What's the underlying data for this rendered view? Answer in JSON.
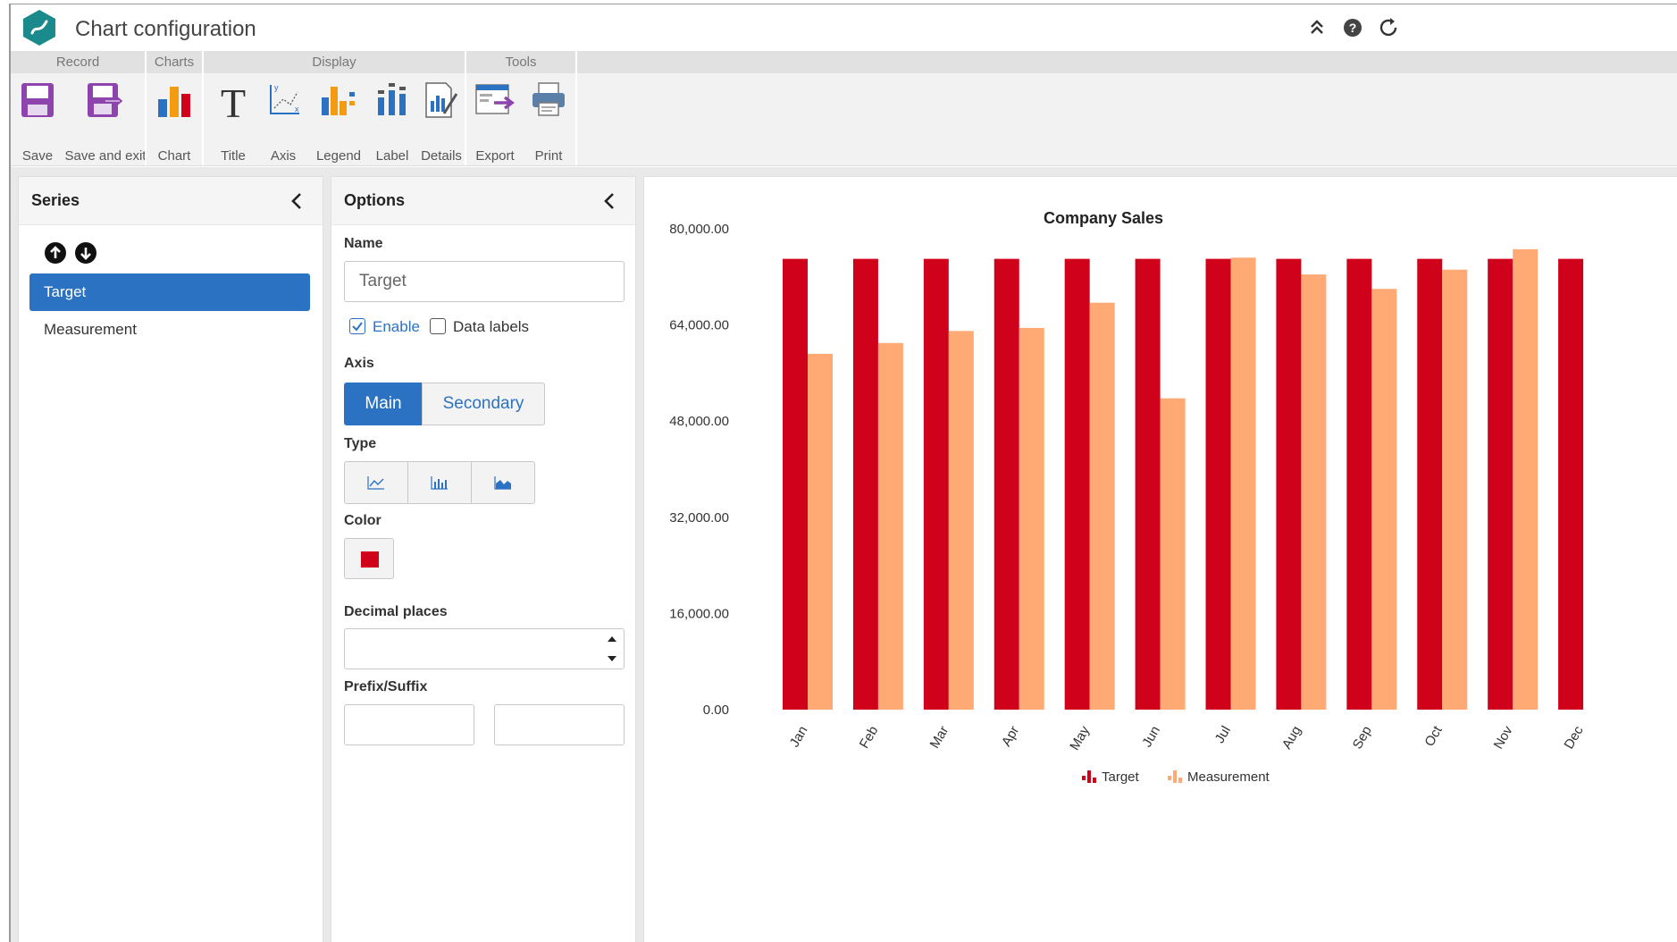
{
  "window": {
    "title": "Chart configuration",
    "icons": [
      "app-logo",
      "collapse-ribbon-icon",
      "help-icon",
      "refresh-icon"
    ]
  },
  "ribbon": {
    "groups": [
      {
        "label": "Record",
        "buttons": [
          {
            "label": "Save",
            "icon": "save-icon"
          },
          {
            "label": "Save and exit",
            "icon": "save-exit-icon"
          }
        ]
      },
      {
        "label": "Charts",
        "buttons": [
          {
            "label": "Chart",
            "icon": "chart-icon"
          }
        ]
      },
      {
        "label": "Display",
        "buttons": [
          {
            "label": "Title",
            "icon": "title-icon"
          },
          {
            "label": "Axis",
            "icon": "axis-icon"
          },
          {
            "label": "Legend",
            "icon": "legend-icon"
          },
          {
            "label": "Label",
            "icon": "label-icon"
          },
          {
            "label": "Details",
            "icon": "details-icon"
          }
        ]
      },
      {
        "label": "Tools",
        "buttons": [
          {
            "label": "Export",
            "icon": "export-icon"
          },
          {
            "label": "Print",
            "icon": "print-icon"
          }
        ]
      }
    ]
  },
  "series_panel": {
    "title": "Series",
    "items": [
      {
        "label": "Target",
        "selected": true
      },
      {
        "label": "Measurement",
        "selected": false
      }
    ]
  },
  "options_panel": {
    "title": "Options",
    "name_label": "Name",
    "name_value": "Target",
    "enable_label": "Enable",
    "enable_checked": true,
    "data_labels_label": "Data labels",
    "data_labels_checked": false,
    "axis_label": "Axis",
    "axis_options": [
      {
        "label": "Main",
        "active": true
      },
      {
        "label": "Secondary",
        "active": false
      }
    ],
    "type_label": "Type",
    "type_options": [
      "line-chart-icon",
      "bar-chart-icon",
      "area-chart-icon"
    ],
    "color_label": "Color",
    "color_value": "#d0021b",
    "decimal_label": "Decimal places",
    "decimal_value": "",
    "prefix_suffix_label": "Prefix/Suffix",
    "prefix_value": "",
    "suffix_value": ""
  },
  "chart_data": {
    "type": "bar",
    "title": "Company Sales",
    "categories": [
      "Jan",
      "Feb",
      "Mar",
      "Apr",
      "May",
      "Jun",
      "Jul",
      "Aug",
      "Sep",
      "Oct",
      "Nov",
      "Dec"
    ],
    "series": [
      {
        "name": "Target",
        "color": "#d0021b",
        "values": [
          75000,
          75000,
          75000,
          75000,
          75000,
          75000,
          75000,
          75000,
          75000,
          75000,
          75000,
          75000
        ]
      },
      {
        "name": "Measurement",
        "color": "#ffaa75",
        "values": [
          59200,
          61000,
          63000,
          63500,
          67700,
          51800,
          75200,
          72400,
          70000,
          73200,
          76600,
          null
        ]
      }
    ],
    "y_ticks": [
      "0.00",
      "16,000.00",
      "32,000.00",
      "48,000.00",
      "64,000.00",
      "80,000.00"
    ],
    "ylim": [
      0,
      80000
    ],
    "xlabel": "",
    "ylabel": "",
    "grid": false,
    "legend_position": "bottom"
  }
}
